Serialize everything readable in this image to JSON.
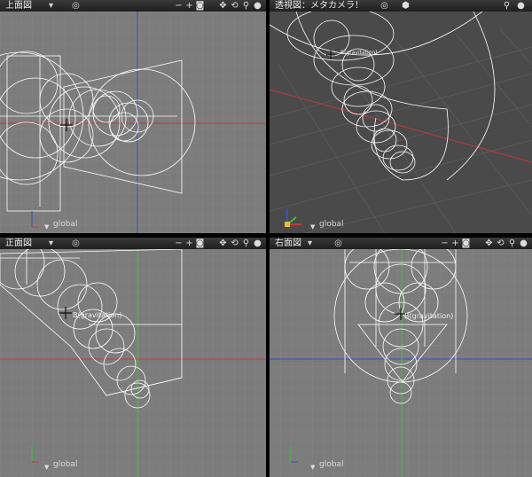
{
  "viewports": {
    "top": {
      "title": "上面図",
      "shading_icon": "target-icon",
      "label": "global"
    },
    "persp": {
      "title": "透視図：メタカメラ！",
      "shading_icon": "target-icon",
      "cube_icon": "cube-icon",
      "label": "global",
      "marker": "B(gravitation)"
    },
    "front": {
      "title": "正面図",
      "shading_icon": "target-icon",
      "label": "global",
      "marker": "B(gravitation)"
    },
    "right": {
      "title": "右面図",
      "shading_icon": "target-icon",
      "label": "global",
      "marker": "B(gravitation)"
    }
  },
  "toolbar": {
    "minus": "−",
    "plus": "+",
    "camera": "📷",
    "move": "✥",
    "rotate": "⟲",
    "zoom": "🔍",
    "sphere": "●",
    "menu_arrow": "▾"
  },
  "colors": {
    "viewport_bg": "#7c7c7c",
    "persp_bg": "#4a4a4a",
    "header_bg": "#2a2a2a",
    "wire": "#ffffff",
    "axis_red": "#c23a3a",
    "axis_blue": "#3a4fc2",
    "axis_green": "#3ac23a"
  }
}
